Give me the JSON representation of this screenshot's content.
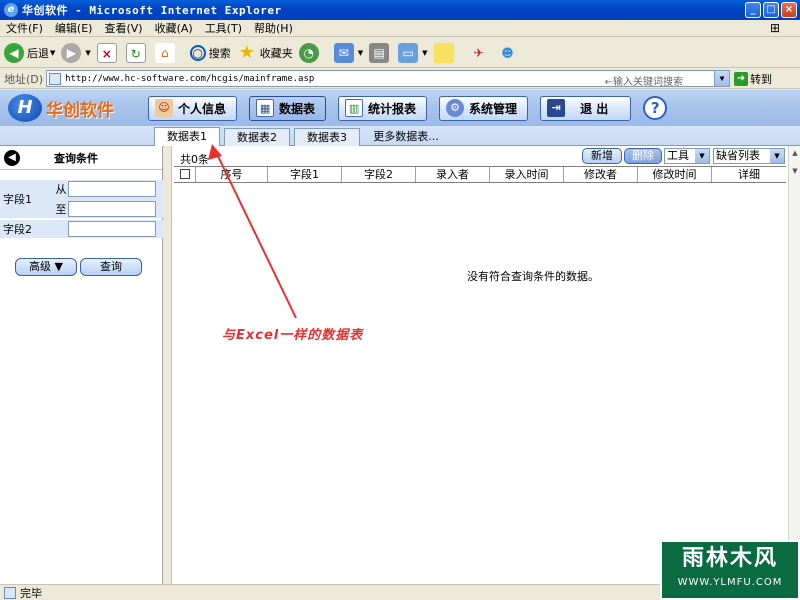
{
  "window": {
    "title": "华创软件 - Microsoft Internet Explorer",
    "minimize": "_",
    "maximize": "□",
    "close": "×"
  },
  "menu": [
    "文件(F)",
    "编辑(E)",
    "查看(V)",
    "收藏(A)",
    "工具(T)",
    "帮助(H)"
  ],
  "toolbar": {
    "back": "后退",
    "search": "搜索",
    "favorites": "收藏夹"
  },
  "address": {
    "label": "地址(D)",
    "url": "http://www.hc-software.com/hcgis/mainframe.asp",
    "hint": "←输入关键词搜索",
    "go": "转到"
  },
  "app": {
    "logo_text": "华创软件",
    "nav": [
      {
        "label": "个人信息",
        "icon": "user-icon",
        "active": false
      },
      {
        "label": "数据表",
        "icon": "table-icon",
        "active": true
      },
      {
        "label": "统计报表",
        "icon": "report-icon",
        "active": false
      },
      {
        "label": "系统管理",
        "icon": "gear-icon",
        "active": false
      },
      {
        "label": "退 出",
        "icon": "exit-icon",
        "active": false
      }
    ],
    "help": "?"
  },
  "tabs": [
    "数据表1",
    "数据表2",
    "数据表3",
    "更多数据表..."
  ],
  "query": {
    "title": "查询条件",
    "field1_label": "字段1",
    "from_label": "从",
    "to_label": "至",
    "field2_label": "字段2",
    "advanced_button": "高级 ▼",
    "query_button": "查询"
  },
  "grid": {
    "count_text": "共0条",
    "new_button": "新增",
    "delete_button": "删除",
    "tools_select": "工具",
    "view_select": "缺省列表",
    "columns": [
      "序号",
      "字段1",
      "字段2",
      "录入者",
      "录入时间",
      "修改者",
      "修改时间",
      "详细"
    ],
    "empty_message": "没有符合查询条件的数据。"
  },
  "annotation": {
    "text": "与Excel一样的数据表",
    "color": "#e83030"
  },
  "status": {
    "text": "完毕"
  },
  "watermark": {
    "line1": "雨林木风",
    "line2": "WWW.YLMFU.COM"
  }
}
